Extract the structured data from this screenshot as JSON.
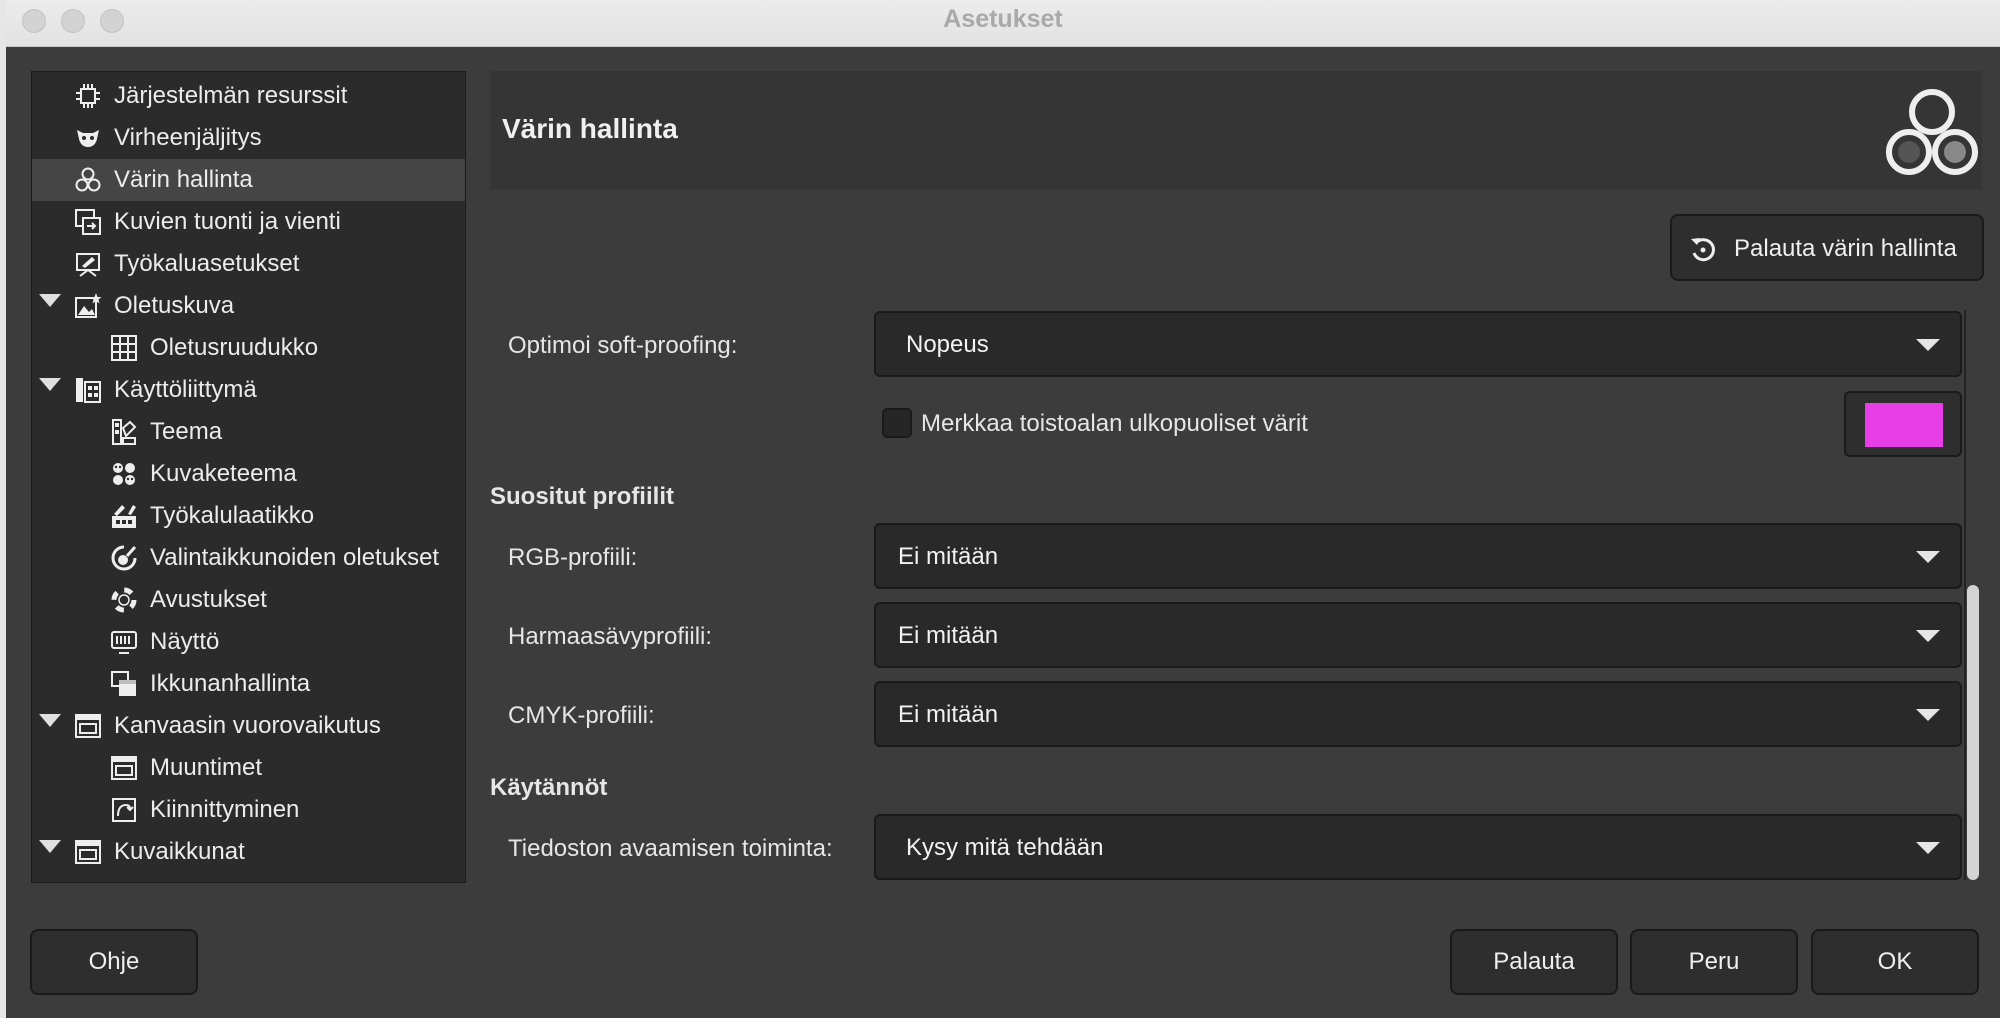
{
  "window": {
    "title": "Asetukset"
  },
  "sidebar": {
    "items": [
      {
        "label": "Järjestelmän resurssit",
        "icon": "chip-icon"
      },
      {
        "label": "Virheenjäljitys",
        "icon": "bug-icon"
      },
      {
        "label": "Värin hallinta",
        "icon": "color-circles-icon",
        "selected": true
      },
      {
        "label": "Kuvien tuonti ja vienti",
        "icon": "import-export-icon"
      },
      {
        "label": "Työkaluasetukset",
        "icon": "tool-options-icon"
      },
      {
        "label": "Oletuskuva",
        "icon": "default-image-icon",
        "expanded": true
      },
      {
        "label": "Oletusruudukko",
        "icon": "grid-icon"
      },
      {
        "label": "Käyttöliittymä",
        "icon": "interface-icon",
        "expanded": true
      },
      {
        "label": "Teema",
        "icon": "theme-icon"
      },
      {
        "label": "Kuvaketeema",
        "icon": "icon-theme-icon"
      },
      {
        "label": "Työkalulaatikko",
        "icon": "toolbox-icon"
      },
      {
        "label": "Valintaikkunoiden oletukset",
        "icon": "dialog-defaults-icon"
      },
      {
        "label": "Avustukset",
        "icon": "lifebuoy-icon"
      },
      {
        "label": "Näyttö",
        "icon": "display-icon"
      },
      {
        "label": "Ikkunanhallinta",
        "icon": "window-management-icon"
      },
      {
        "label": "Kanvaasin vuorovaikutus",
        "icon": "canvas-icon",
        "expanded": true
      },
      {
        "label": "Muuntimet",
        "icon": "modifiers-icon"
      },
      {
        "label": "Kiinnittyminen",
        "icon": "snapping-icon"
      },
      {
        "label": "Kuvaikkunat",
        "icon": "image-windows-icon",
        "expanded": true
      }
    ]
  },
  "header": {
    "title": "Värin hallinta",
    "icon": "color-circles-icon"
  },
  "reset_button": {
    "label": "Palauta värin hallinta",
    "icon": "reset-icon"
  },
  "softproof": {
    "label": "Optimoi soft-proofing:",
    "value": "Nopeus",
    "gamut_check_label": "Merkkaa toistoalan ulkopuoliset värit",
    "gamut_checked": false,
    "gamut_color": "#e83ee8"
  },
  "preferred_profiles": {
    "heading": "Suositut profiilit",
    "rgb": {
      "label": "RGB-profiili:",
      "value": "Ei mitään"
    },
    "gray": {
      "label": "Harmaasävyprofiili:",
      "value": "Ei mitään"
    },
    "cmyk": {
      "label": "CMYK-profiili:",
      "value": "Ei mitään"
    }
  },
  "policies": {
    "heading": "Käytännöt",
    "file_open": {
      "label": "Tiedoston avaamisen toiminta:",
      "value": "Kysy mitä tehdään"
    }
  },
  "footer": {
    "help": "Ohje",
    "reset": "Palauta",
    "cancel": "Peru",
    "ok": "OK"
  }
}
